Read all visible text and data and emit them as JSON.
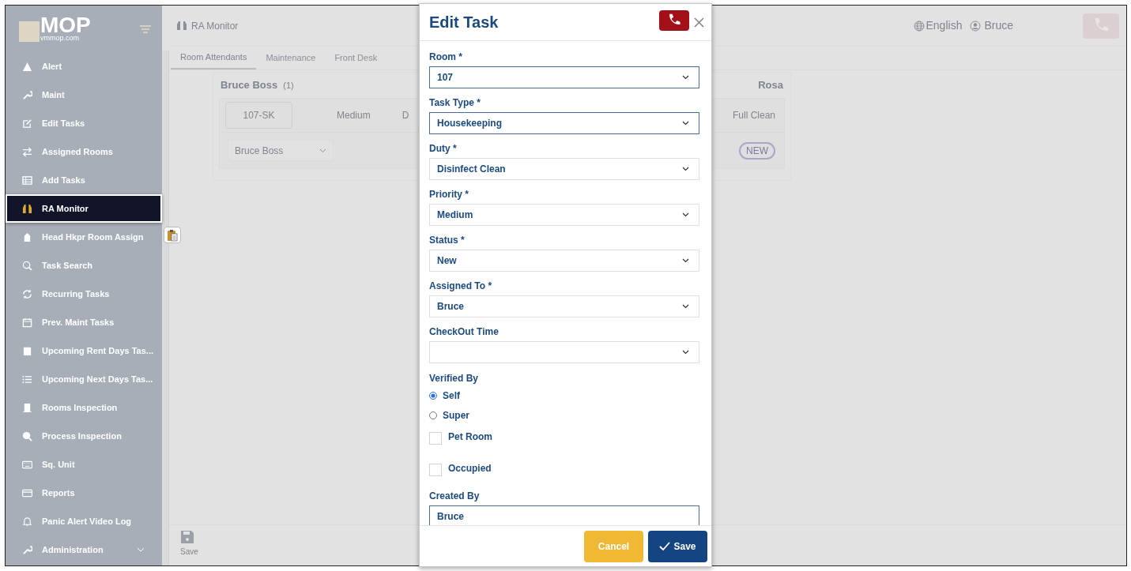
{
  "logo": {
    "text": "MOP",
    "subtitle": "vmmop.com"
  },
  "sidebar": {
    "items": [
      {
        "label": "Alert",
        "selected": false
      },
      {
        "label": "Maint",
        "selected": false
      },
      {
        "label": "Edit Tasks",
        "selected": false
      },
      {
        "label": "Assigned Rooms",
        "selected": false
      },
      {
        "label": "Add Tasks",
        "selected": false
      },
      {
        "label": "RA Monitor",
        "selected": true
      },
      {
        "label": "Head Hkpr Room Assign",
        "selected": false
      },
      {
        "label": "Task Search",
        "selected": false
      },
      {
        "label": "Recurring Tasks",
        "selected": false
      },
      {
        "label": "Prev. Maint Tasks",
        "selected": false
      },
      {
        "label": "Upcoming Rent Days Tas...",
        "selected": false
      },
      {
        "label": "Upcoming Next Days Tas...",
        "selected": false
      },
      {
        "label": "Rooms Inspection",
        "selected": false
      },
      {
        "label": "Process Inspection",
        "selected": false
      },
      {
        "label": "Sq. Unit",
        "selected": false
      },
      {
        "label": "Reports",
        "selected": false
      },
      {
        "label": "Panic Alert Video Log",
        "selected": false
      },
      {
        "label": "Administration",
        "selected": false
      }
    ]
  },
  "header": {
    "title": "RA Monitor",
    "language": "English",
    "user": "Bruce"
  },
  "tabs": [
    {
      "label": "Room Attendants",
      "selected": true
    },
    {
      "label": "Maintenance",
      "selected": false
    },
    {
      "label": "Front Desk",
      "selected": false
    }
  ],
  "card": {
    "name": "Bruce Boss",
    "count": "(1)",
    "room": "107-SK",
    "priority": "Medium",
    "column_3": "D",
    "assignee": "Bruce Boss",
    "right_name": "Rosa",
    "right_duty": "Full Clean",
    "right_status": "NEW"
  },
  "footer": {
    "save_label": "Save"
  },
  "modal": {
    "title": "Edit Task",
    "fields": [
      {
        "kind": "select",
        "label": "Room *",
        "value": "107",
        "highlighted": true
      },
      {
        "kind": "select",
        "label": "Task Type *",
        "value": "Housekeeping",
        "highlighted": true
      },
      {
        "kind": "select",
        "label": "Duty *",
        "value": "Disinfect Clean",
        "highlighted": false
      },
      {
        "kind": "select",
        "label": "Priority *",
        "value": "Medium",
        "highlighted": false
      },
      {
        "kind": "select",
        "label": "Status *",
        "value": "New",
        "highlighted": false
      },
      {
        "kind": "select",
        "label": "Assigned To *",
        "value": "Bruce",
        "highlighted": false
      },
      {
        "kind": "select",
        "label": "CheckOut Time",
        "highlighted": false
      },
      {
        "kind": "radio",
        "label": "Verified By",
        "options": [
          {
            "label": "Self",
            "selected": true
          },
          {
            "label": "Super",
            "selected": false
          }
        ]
      },
      {
        "kind": "checkbox",
        "label": "Pet Room",
        "checked": false
      },
      {
        "kind": "checkbox",
        "label": "Occupied",
        "checked": false
      },
      {
        "kind": "text",
        "label": "Created By",
        "value": "Bruce",
        "highlighted": true
      }
    ],
    "cancel": "Cancel",
    "save": "Save"
  }
}
